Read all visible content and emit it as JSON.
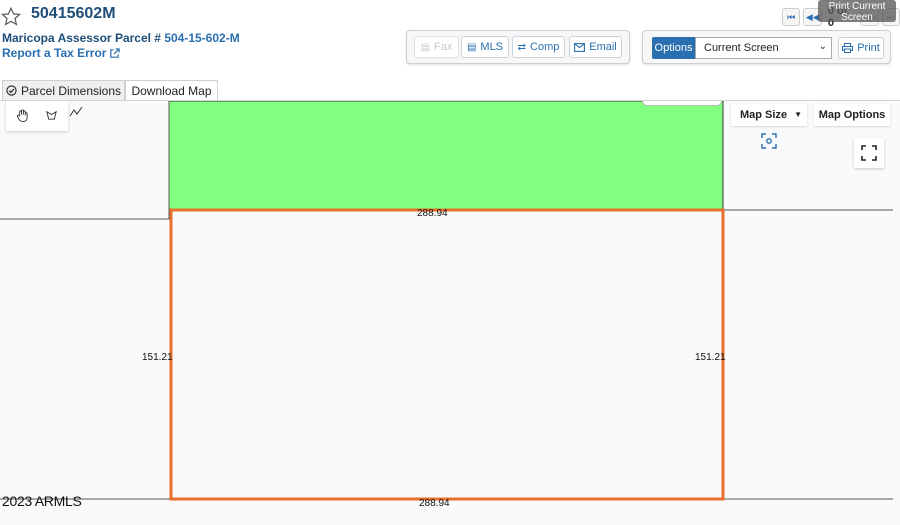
{
  "header": {
    "title": "50415602M",
    "parcel_prefix": "Maricopa Assessor Parcel # ",
    "parcel_number": "504-15-602-M",
    "tax_error_label": "Report a Tax Error"
  },
  "pager": {
    "count": "0 of 0",
    "tooltip": "Print Current Screen"
  },
  "actions": {
    "fax": "Fax",
    "mls": "MLS",
    "comp": "Comp",
    "email": "Email"
  },
  "options": {
    "label": "Options",
    "selected": "Current Screen",
    "print": "Print"
  },
  "tabs": {
    "parcel_dimensions": "Parcel Dimensions",
    "download_map": "Download Map"
  },
  "map": {
    "map_size": "Map Size",
    "map_options": "Map Options",
    "copyright": "2023 ARMLS",
    "dimensions": {
      "top": "288.94",
      "bottom": "288.94",
      "left": "151.21",
      "right": "151.21"
    },
    "colors": {
      "neighbor_parcel": "#80ff80",
      "selected_parcel_outline": "#e8702a"
    }
  },
  "icons": {
    "star": "star-outline-icon",
    "external_link": "external-link-icon",
    "first": "first-page-icon",
    "prev": "previous-icon",
    "next": "next-icon",
    "last": "last-page-icon",
    "fax": "fax-icon",
    "mls": "mls-card-icon",
    "comp": "compare-arrows-icon",
    "email": "envelope-icon",
    "print": "printer-icon",
    "check_circle": "check-circle-icon",
    "pan": "hand-pan-icon",
    "polygon": "polygon-draw-icon",
    "line": "line-draw-icon",
    "locate": "locate-crosshair-icon",
    "fullscreen": "fullscreen-icon"
  }
}
